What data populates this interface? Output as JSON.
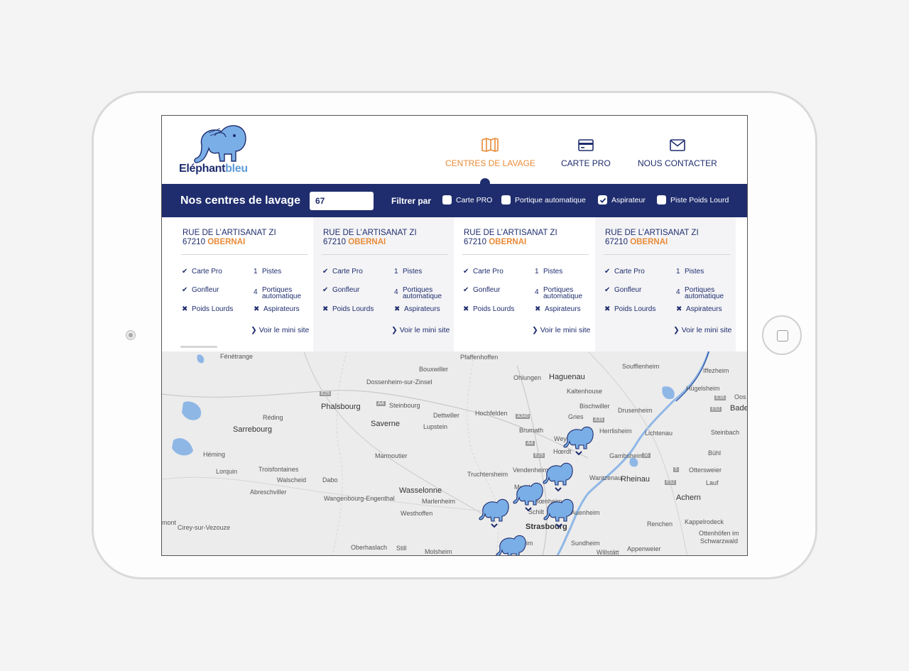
{
  "brand": {
    "name_a": "Eléphant",
    "name_b": "bleu",
    "color_dark": "#1f2d6e",
    "color_light": "#5f9bd8"
  },
  "nav": [
    {
      "label": "CENTRES DE LAVAGE",
      "icon": "map-icon",
      "active": true
    },
    {
      "label": "CARTE PRO",
      "icon": "credit-card-icon",
      "active": false
    },
    {
      "label": "NOUS CONTACTER",
      "icon": "envelope-icon",
      "active": false
    }
  ],
  "accent_color": "#e98b38",
  "search": {
    "title": "Nos centres de lavage",
    "value": "67",
    "filter_label": "Filtrer par"
  },
  "filters": [
    {
      "label": "Carte PRO",
      "checked": false
    },
    {
      "label": "Portique automatique",
      "checked": false
    },
    {
      "label": "Aspirateur",
      "checked": true
    },
    {
      "label": "Piste Poids Lourd",
      "checked": false
    }
  ],
  "stations": [
    {
      "street": "RUE DE L’ARTISANAT ZI",
      "postcode": "67210",
      "city": "OBERNAI",
      "carte_pro": "Carte Pro",
      "gonfleur": "Gonfleur",
      "poids": "Poids Lourds",
      "pistes_n": "1",
      "pistes": "Pistes",
      "portiques_n": "4",
      "portiques_a": "Portiques",
      "portiques_b": "automatique",
      "aspirateurs": "Aspirateurs",
      "link": "Voir le mini site"
    },
    {
      "street": "RUE DE L’ARTISANAT ZI",
      "postcode": "67210",
      "city": "OBERNAI",
      "carte_pro": "Carte Pro",
      "gonfleur": "Gonfleur",
      "poids": "Poids Lourds",
      "pistes_n": "1",
      "pistes": "Pistes",
      "portiques_n": "4",
      "portiques_a": "Portiques",
      "portiques_b": "automatique",
      "aspirateurs": "Aspirateurs",
      "link": "Voir le mini site"
    },
    {
      "street": "RUE DE L’ARTISANAT ZI",
      "postcode": "67210",
      "city": "OBERNAI",
      "carte_pro": "Carte Pro",
      "gonfleur": "Gonfleur",
      "poids": "Poids Lourds",
      "pistes_n": "1",
      "pistes": "Pistes",
      "portiques_n": "4",
      "portiques_a": "Portiques",
      "portiques_b": "automatique",
      "aspirateurs": "Aspirateurs",
      "link": "Voir le mini site"
    },
    {
      "street": "RUE DE L’ARTISANAT ZI",
      "postcode": "67210",
      "city": "OBERNAI",
      "carte_pro": "Carte Pro",
      "gonfleur": "Gonfleur",
      "poids": "Poids Lourds",
      "pistes_n": "1",
      "pistes": "Pistes",
      "portiques_n": "4",
      "portiques_a": "Portiques",
      "portiques_b": "automatique",
      "aspirateurs": "Aspirateurs",
      "link": "Voir le mini site"
    }
  ],
  "map": {
    "places": {
      "fenetrange": "Fénétrange",
      "bouxwiller": "Bouxwiller",
      "pfaffenhoffen": "Pfaffenhoffen",
      "soufflenheim": "Soufflenheim",
      "iffezheim": "Iffezheim",
      "ohlungen": "Ohlungen",
      "haguenau": "Haguenau",
      "dossenheim": "Dossenheim-sur-Zinsel",
      "kaltenhouse": "Kaltenhouse",
      "hugelsheim": "Hügelsheim",
      "oos": "Oos",
      "phalsbourg": "Phalsbourg",
      "steinbourg": "Steinbourg",
      "bischwiller": "Bischwiller",
      "drusenheim": "Drusenheim",
      "bade": "Bade",
      "reding": "Réding",
      "dettwiller": "Dettwiller",
      "hochfelden": "Hochfelden",
      "gries": "Gries",
      "sarrebourg": "Sarrebourg",
      "saverne": "Saverne",
      "lupstein": "Lupstein",
      "brumath": "Brumath",
      "weyer": "Weye",
      "herrlisheim": "Herrlisheim",
      "lichtenau": "Lichtenau",
      "steinbach": "Steinbach",
      "heming": "Héming",
      "marmoutier": "Marmoutier",
      "hoerdt": "Hœrdt",
      "gambsheim": "Gambsheim",
      "buhl": "Bühl",
      "lorquin": "Lorquin",
      "troisfontaines": "Troisfontaines",
      "truchtersheim": "Truchtersheim",
      "vendenheim": "Vendenheim",
      "wantzenau": "Wantzenau",
      "ottersweier": "Ottersweier",
      "walscheid": "Walscheid",
      "dabo": "Dabo",
      "rheinau": "Rheinau",
      "lauf": "Lauf",
      "abreschviller": "Abreschviller",
      "wasselonne": "Wasselonne",
      "mundolsheim": "Mundo",
      "wangenbourg": "Wangenbourg-Engenthal",
      "marlenheim": "Marlenheim",
      "hoenheim": "Hœnheim",
      "achern": "Achern",
      "westhoffen": "Westhoffen",
      "schiltigheim": "Schilt",
      "auenheim": "Auenheim",
      "mont": "mont",
      "cirey": "Cirey-sur-Vezouze",
      "strasbourg": "Strasbourg",
      "renchen": "Renchen",
      "kappelrodeck": "Kappelrodeck",
      "ottenhofen": "Ottenhöfen im",
      "schwarzwald": "Schwarzwald",
      "sundheim": "Sundheim",
      "oberhaslach": "Oberhaslach",
      "still": "Still",
      "molsheim": "Molsheim",
      "willstatt": "Willstätt",
      "appenweier": "Appenweier",
      "eim": "eim"
    },
    "roads": {
      "e25a": "E25",
      "a4": "A4",
      "a340": "A340",
      "a35": "A35",
      "e52a": "E52",
      "a4b": "A4",
      "e25b": "E25",
      "e35": "E35",
      "e52b": "E52",
      "n36": "36",
      "n5": "5"
    }
  }
}
